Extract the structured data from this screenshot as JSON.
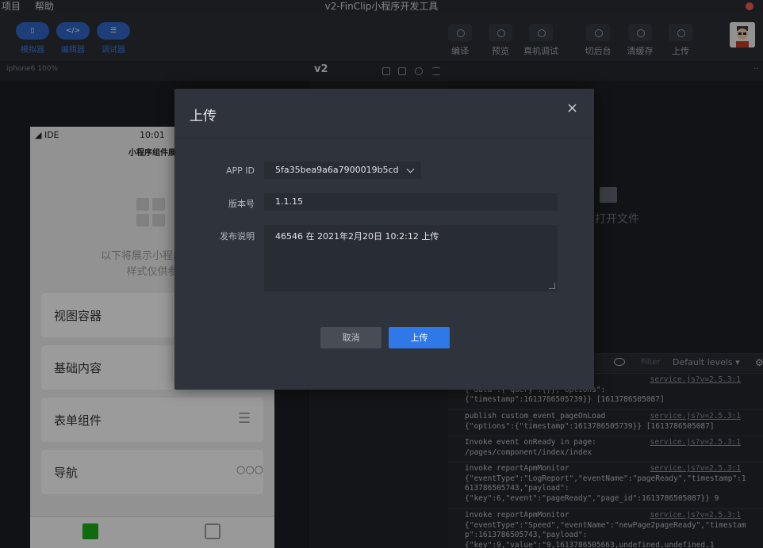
{
  "menubar": {
    "items": [
      "项目",
      "帮助"
    ],
    "title": "v2-FinClip小程序开发工具"
  },
  "toolbar": {
    "left": [
      {
        "label": "模拟器",
        "icon": "phone-icon"
      },
      {
        "label": "编辑器",
        "icon": "code-icon"
      },
      {
        "label": "调试器",
        "icon": "debug-icon"
      }
    ],
    "right": [
      {
        "label": "编译",
        "icon": "compile-icon"
      },
      {
        "label": "预览",
        "icon": "preview-icon"
      },
      {
        "label": "真机调试",
        "icon": "remote-debug-icon"
      },
      {
        "label": "切后台",
        "icon": "background-icon"
      },
      {
        "label": "清缓存",
        "icon": "clear-cache-icon"
      },
      {
        "label": "上传",
        "icon": "upload-icon"
      }
    ]
  },
  "subbar": {
    "device": "iphone6 100%",
    "project": "v2"
  },
  "phone": {
    "status_left": "IDE",
    "time": "10:01",
    "nav_title": "小程序组件展",
    "desc_line1": "以下将展示小程序官方",
    "desc_line2": "样式仅供参",
    "items": [
      "视图容器",
      "基础内容",
      "表单组件",
      "导航"
    ]
  },
  "editor": {
    "open_file": "打开文件"
  },
  "console": {
    "filter": "Filter",
    "levels": "Default levels ▾",
    "logs": [
      {
        "msg": "                  geonshow\n{\"data\":{\"query\":{}},\"options\":\n{\"timestamp\":1613786505739}} [1613786505087]",
        "src": "service.js?v=2.5.3:1"
      },
      {
        "msg": "publish custom_event_pageOnLoad\n{\"options\":{\"timestamp\":1613786505739}} [1613786505087]",
        "src": "service.js?v=2.5.3:1"
      },
      {
        "msg": "Invoke event onReady in page:\n/pages/component/index/index",
        "src": "service.js?v=2.5.3:1"
      },
      {
        "msg": "invoke reportApmMonitor\n{\"eventType\":\"LogReport\",\"eventName\":\"pageReady\",\"timestamp\":1613786505743,\"payload\":\n{\"key\":6,\"event\":\"pageReady\",\"page_id\":1613786505087}} 9",
        "src": "service.js?v=2.5.3:1"
      },
      {
        "msg": "invoke reportApmMonitor\n{\"eventType\":\"Speed\",\"eventName\":\"newPage2pageReady\",\"timestamp\":1613786505743,\"payload\":\n{\"key\":9,\"value\":\"9,1613786505663,undefined,undefined,1",
        "src": "service.js?v=2.5.3:1"
      }
    ]
  },
  "dialog": {
    "title": "上传",
    "close": "×",
    "appid_label": "APP ID",
    "appid_value": "5fa35bea9a6a7900019b5cd",
    "version_label": "版本号",
    "version_value": "1.1.15",
    "note_label": "发布说明",
    "note_value": "46546 在 2021年2月20日 10:2:12 上传",
    "cancel": "取消",
    "submit": "上传"
  },
  "colors": {
    "accent": "#2f78e8",
    "dialog_bg": "#2f333b",
    "field_bg": "#282c33"
  }
}
